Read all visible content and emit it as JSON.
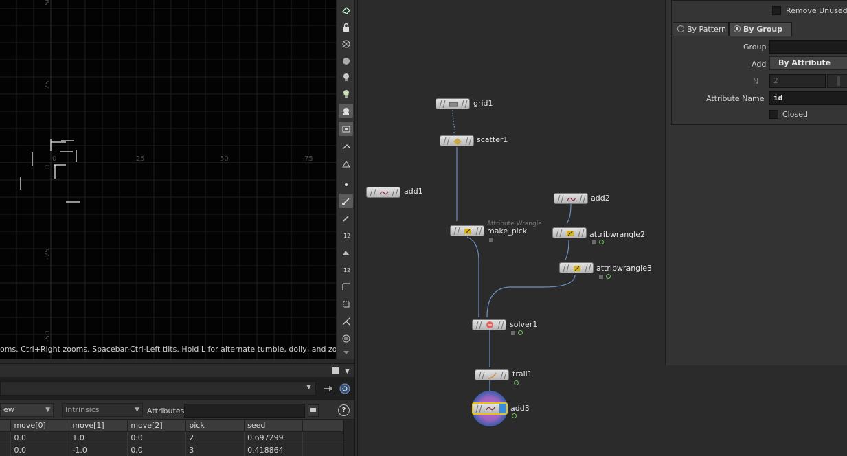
{
  "viewport": {
    "hint": "oms. Ctrl+Right zooms. Spacebar-Ctrl-Left tilts. Hold L for alternate tumble, dolly, and zoom.",
    "axis_labels": {
      "x": [
        "0",
        "25",
        "50",
        "75"
      ],
      "y": [
        "50",
        "25",
        "0",
        "-25",
        "-50"
      ]
    }
  },
  "viewport_toolbar": {
    "icons": [
      "select-icon",
      "lock-icon",
      "ghost-icon",
      "display-icon",
      "light-icon",
      "light-toggle-icon",
      "camera-icon",
      "snap-icon",
      "pose-icon",
      "handle-icon",
      "point-icon",
      "brush-icon",
      "pen-icon",
      "number-12-icon",
      "sculpt-icon",
      "number-12-alt-icon",
      "curve-icon",
      "transform-icon",
      "split-icon",
      "menu-icon"
    ]
  },
  "spreadsheet": {
    "view_dropdown": "ew",
    "intrinsics_dropdown": "Intrinsics",
    "attributes_label": "Attributes:",
    "attributes_value": "",
    "help_label": "?",
    "columns": [
      "",
      "move[0]",
      "move[1]",
      "move[2]",
      "pick",
      "seed",
      ""
    ],
    "rows": [
      [
        "",
        "0.0",
        "1.0",
        "0.0",
        "2",
        "0.697299",
        ""
      ],
      [
        "",
        "0.0",
        "-1.0",
        "0.0",
        "3",
        "0.418864",
        ""
      ]
    ]
  },
  "network": {
    "nodes": [
      {
        "id": "grid1",
        "label": "grid1"
      },
      {
        "id": "scatter1",
        "label": "scatter1"
      },
      {
        "id": "add1",
        "label": "add1"
      },
      {
        "id": "make_pick",
        "label": "make_pick",
        "sublabel": "Attribute Wrangle"
      },
      {
        "id": "add2",
        "label": "add2"
      },
      {
        "id": "attribwrangle2",
        "label": "attribwrangle2"
      },
      {
        "id": "attribwrangle3",
        "label": "attribwrangle3"
      },
      {
        "id": "solver1",
        "label": "solver1"
      },
      {
        "id": "trail1",
        "label": "trail1"
      },
      {
        "id": "add3",
        "label": "add3"
      }
    ],
    "colors": {
      "wire": "#6f8fc4",
      "selected": "#e5c31a",
      "display_flag": "#3b5da8"
    }
  },
  "params": {
    "remove_unused_label": "Remove Unused Poi",
    "tab_pattern": "By Pattern",
    "tab_group": "By Group",
    "group_label": "Group",
    "group_value": "",
    "add_label": "Add",
    "add_value": "By Attribute",
    "n_label": "N",
    "n_value": "2",
    "attr_name_label": "Attribute Name",
    "attr_name_value": "id",
    "closed_label": "Closed"
  }
}
